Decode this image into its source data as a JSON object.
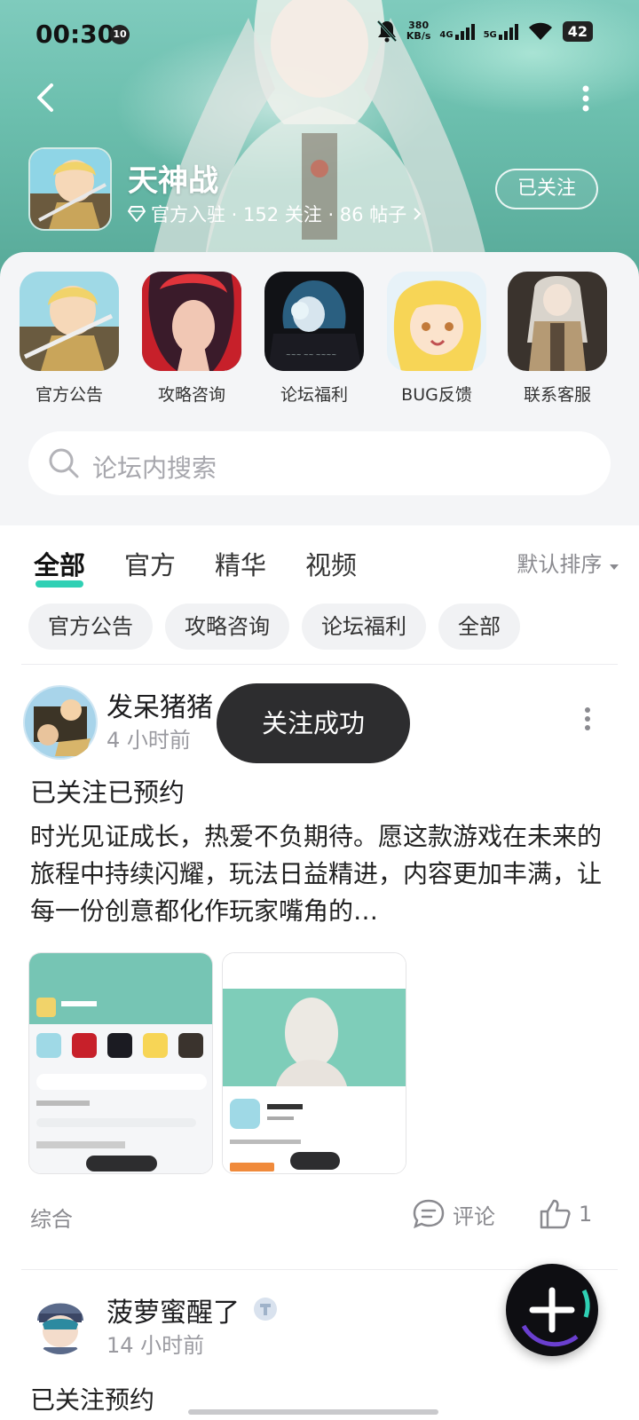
{
  "status_bar": {
    "time": "00:30",
    "notif_badge": "10",
    "speed": "380",
    "speed_unit": "KB/s",
    "net1": "4G",
    "net2": "5G",
    "battery": "42"
  },
  "header": {
    "game_name": "天神战",
    "meta": "官方入驻 · 152 关注 · 86 帖子",
    "follow_label": "已关注"
  },
  "shortcuts": [
    {
      "label": "官方公告"
    },
    {
      "label": "攻略咨询"
    },
    {
      "label": "论坛福利"
    },
    {
      "label": "BUG反馈"
    },
    {
      "label": "联系客服"
    }
  ],
  "search": {
    "placeholder": "论坛内搜索"
  },
  "tabs": [
    {
      "label": "全部",
      "active": true
    },
    {
      "label": "官方"
    },
    {
      "label": "精华"
    },
    {
      "label": "视频"
    }
  ],
  "sort_label": "默认排序",
  "chips": [
    "官方公告",
    "攻略咨询",
    "论坛福利",
    "全部"
  ],
  "posts": [
    {
      "username": "发呆猪猪",
      "time": "4 小时前",
      "title": "已关注已预约",
      "body": "时光见证成长，热爱不负期待。愿这款游戏在未来的旅程中持续闪耀，玩法日益精进，内容更加丰满，让每一份创意都化作玩家嘴角的…",
      "category": "综合",
      "comment_label": "评论",
      "like_count": "1"
    },
    {
      "username": "菠萝蜜醒了",
      "time": "14 小时前",
      "title": "已关注预约"
    }
  ],
  "toast": "关注成功",
  "colors": {
    "accent": "#2fd0b4",
    "banner": "#6cbfae"
  }
}
